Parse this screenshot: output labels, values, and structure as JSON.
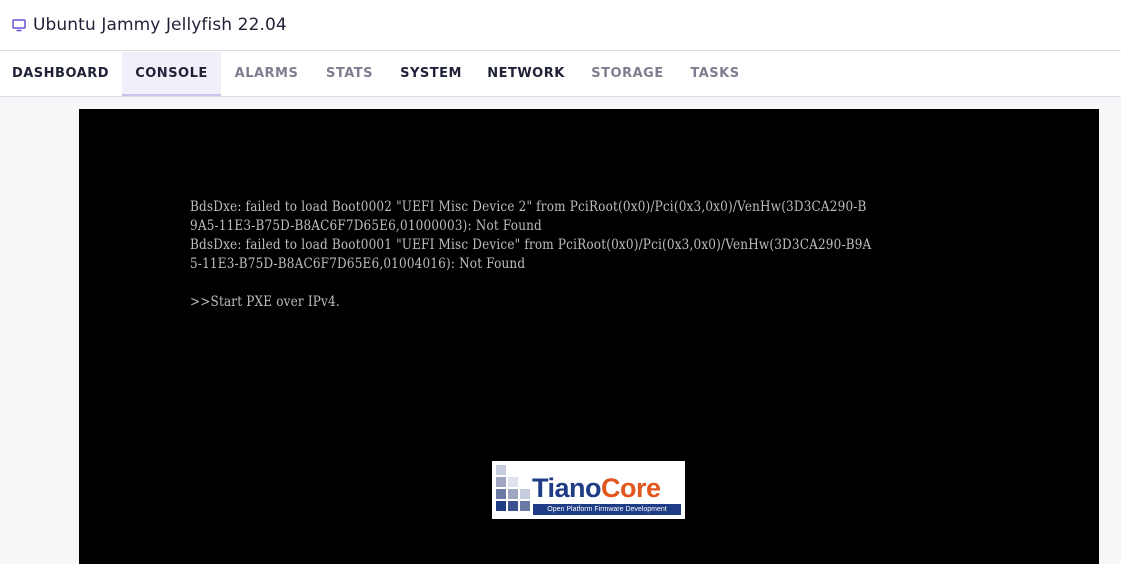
{
  "window": {
    "title": "Ubuntu Jammy Jellyfish 22.04",
    "title_icon": "monitor-icon",
    "icon_color": "#6b4fd8"
  },
  "tabs": [
    {
      "label": "DASHBOARD",
      "state": "default"
    },
    {
      "label": "CONSOLE",
      "state": "active"
    },
    {
      "label": "ALARMS",
      "state": "muted"
    },
    {
      "label": "STATS",
      "state": "muted"
    },
    {
      "label": "SYSTEM",
      "state": "default"
    },
    {
      "label": "NETWORK",
      "state": "default"
    },
    {
      "label": "STORAGE",
      "state": "muted"
    },
    {
      "label": "TASKS",
      "state": "muted"
    }
  ],
  "console": {
    "lines": [
      "BdsDxe: failed to load Boot0002 \"UEFI Misc Device 2\" from PciRoot(0x0)/Pci(0x3,0x0)/VenHw(3D3CA290-B",
      "9A5-11E3-B75D-B8AC6F7D65E6,01000003): Not Found",
      "BdsDxe: failed to load Boot0001 \"UEFI Misc Device\" from PciRoot(0x0)/Pci(0x3,0x0)/VenHw(3D3CA290-B9A",
      "5-11E3-B75D-B8AC6F7D65E6,01004016): Not Found",
      "",
      ">>Start PXE over IPv4."
    ],
    "logo": {
      "brand_part1": "Tiano",
      "brand_part2": "Core",
      "tagline": "Open Platform Firmware Development",
      "colors": {
        "primary": "#1f3c86",
        "accent": "#e1571e"
      }
    }
  }
}
